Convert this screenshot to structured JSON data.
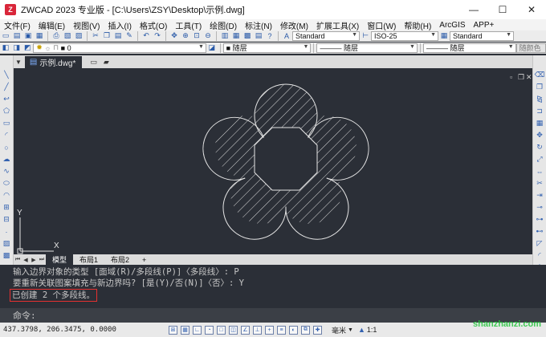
{
  "titlebar": {
    "app_title": "ZWCAD 2023 专业版 - [C:\\Users\\ZSY\\Desktop\\示例.dwg]",
    "logo_letter": "Z",
    "minimize": "—",
    "maximize": "☐",
    "close": "✕"
  },
  "menu": [
    "文件(F)",
    "编辑(E)",
    "视图(V)",
    "插入(I)",
    "格式(O)",
    "工具(T)",
    "绘图(D)",
    "标注(N)",
    "修改(M)",
    "扩展工具(X)",
    "窗口(W)",
    "帮助(H)",
    "ArcGIS",
    "APP+"
  ],
  "toolbar": {
    "text_style": "Standard",
    "dim_style": "ISO-25",
    "table_style": "Standard",
    "layer_value": "0",
    "color_value": "随层",
    "linetype_value": "随层",
    "lineweight_value": "随层",
    "plotstyle_value": "随颜色"
  },
  "document": {
    "tab_label": "示例.dwg*",
    "layout_tabs": [
      "模型",
      "布局1",
      "布局2"
    ],
    "add_tab": "+",
    "ucs_x": "X",
    "ucs_y": "Y",
    "viewport_controls": [
      "▫",
      "❐",
      "✕"
    ]
  },
  "command": {
    "history": [
      "输入边界对象的类型 [面域(R)/多段线(P)]〈多段线〉: P",
      "要重新关联图案填充与新边界吗? [是(Y)/否(N)]〈否〉: Y",
      "已创建 2 个多段线。"
    ],
    "prompt": "命令:"
  },
  "status": {
    "coordinates": "437.3798, 206.3475, 0.0000",
    "unit": "毫米",
    "scale": "1:1",
    "watermark": "shanzhanzi.com"
  },
  "colors": {
    "canvas_bg": "#2b2f37",
    "highlight_border": "#e53030",
    "watermark": "#22c53b"
  }
}
